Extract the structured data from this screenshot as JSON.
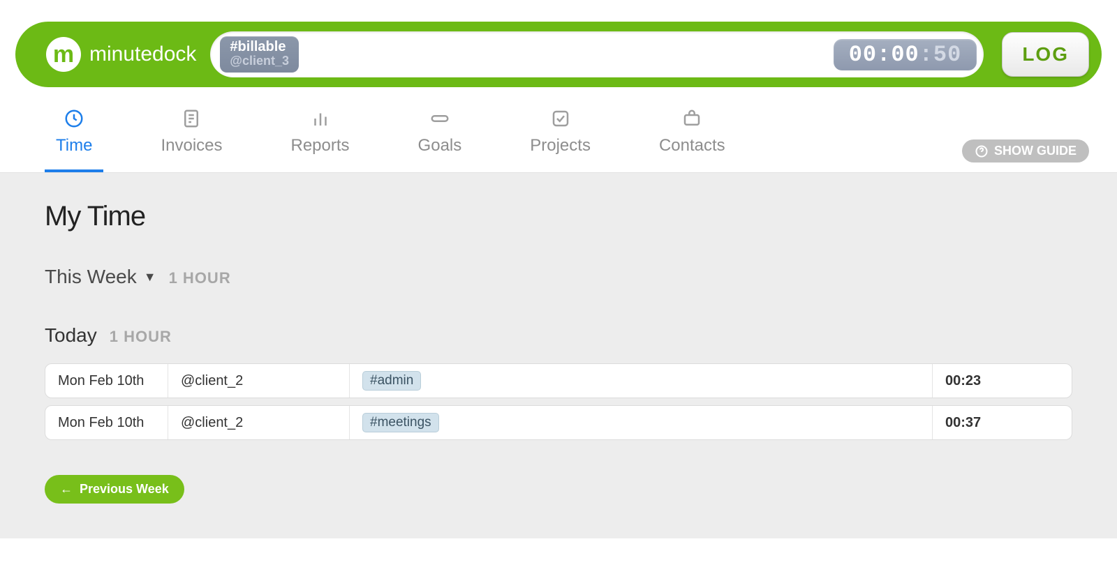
{
  "brand": {
    "name": "minutedock",
    "letter": "m"
  },
  "entry": {
    "tag_line1": "#billable",
    "tag_line2": "@client_3",
    "input_value": "",
    "timer_main": "00:00",
    "timer_seconds": ":50"
  },
  "log_button": "LOG",
  "nav": {
    "items": [
      {
        "label": "Time",
        "icon": "clock",
        "active": true
      },
      {
        "label": "Invoices",
        "icon": "file",
        "active": false
      },
      {
        "label": "Reports",
        "icon": "bars",
        "active": false
      },
      {
        "label": "Goals",
        "icon": "paperclip",
        "active": false
      },
      {
        "label": "Projects",
        "icon": "checkbox",
        "active": false
      },
      {
        "label": "Contacts",
        "icon": "briefcase",
        "active": false
      }
    ],
    "show_guide": "SHOW GUIDE"
  },
  "page_title": "My Time",
  "week": {
    "label": "This Week",
    "summary": "1 HOUR"
  },
  "today": {
    "label": "Today",
    "summary": "1 HOUR"
  },
  "entries": [
    {
      "date": "Mon Feb 10th",
      "client": "@client_2",
      "tag": "#admin",
      "duration": "00:23"
    },
    {
      "date": "Mon Feb 10th",
      "client": "@client_2",
      "tag": "#meetings",
      "duration": "00:37"
    }
  ],
  "prev_week": "Previous Week"
}
